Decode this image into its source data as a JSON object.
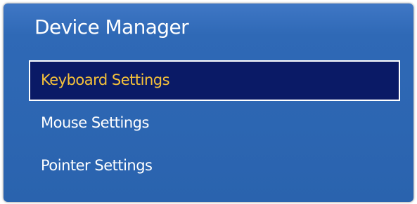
{
  "dialog": {
    "title": "Device Manager"
  },
  "menu": {
    "items": [
      {
        "label": "Keyboard Settings",
        "selected": true
      },
      {
        "label": "Mouse Settings",
        "selected": false
      },
      {
        "label": "Pointer Settings",
        "selected": false
      }
    ]
  },
  "colors": {
    "panel_background": "#2f69b6",
    "selected_background": "#0a1a66",
    "selected_text": "#f5c13a",
    "text": "#ffffff"
  }
}
